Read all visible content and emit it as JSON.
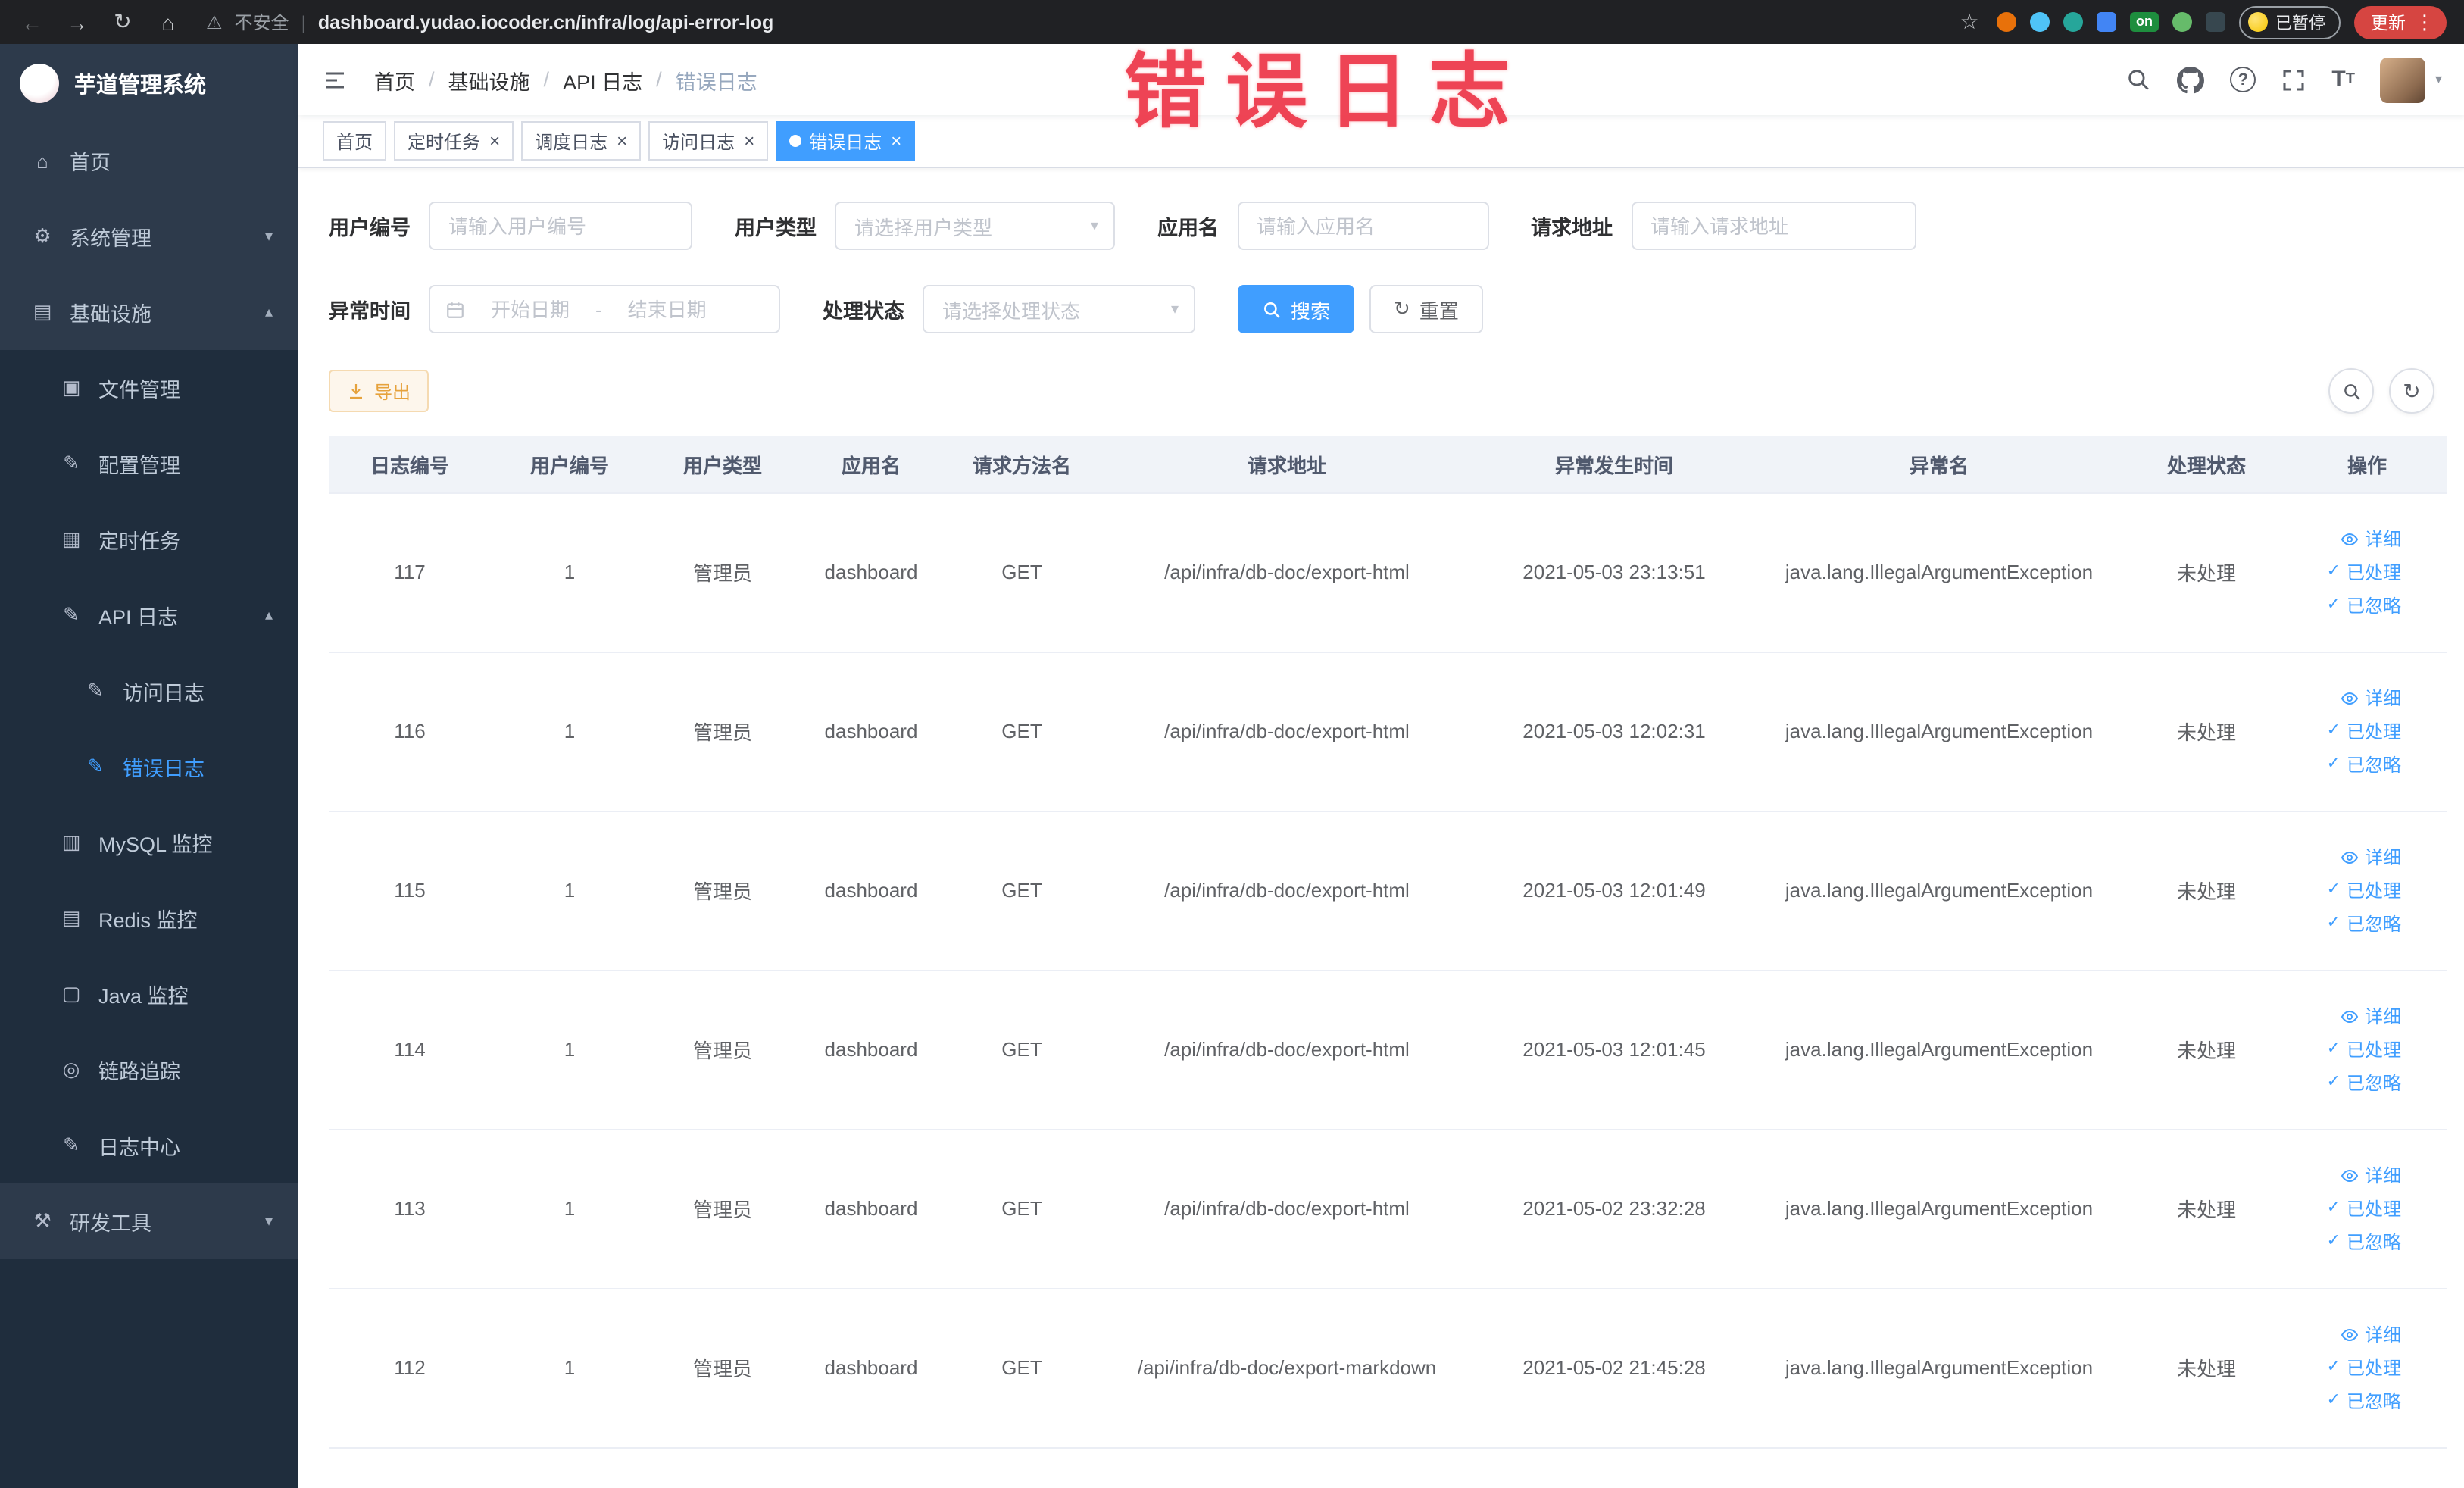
{
  "browser": {
    "security_label": "不安全",
    "url": "dashboard.yudao.iocoder.cn/infra/log/api-error-log",
    "extension_on_badge": "on",
    "paused_badge": "已暂停",
    "update_button": "更新"
  },
  "watermark_text": "错误日志",
  "sidebar": {
    "app_title": "芋道管理系统",
    "items": {
      "home": "首页",
      "system": "系统管理",
      "infra": "基础设施",
      "file": "文件管理",
      "config": "配置管理",
      "job": "定时任务",
      "api_log": "API 日志",
      "access_log": "访问日志",
      "error_log": "错误日志",
      "mysql": "MySQL 监控",
      "redis": "Redis 监控",
      "java": "Java 监控",
      "trace": "链路追踪",
      "log_center": "日志中心",
      "dev_tools": "研发工具"
    }
  },
  "navbar": {
    "breadcrumb": [
      "首页",
      "基础设施",
      "API 日志",
      "错误日志"
    ]
  },
  "tabs": [
    "首页",
    "定时任务",
    "调度日志",
    "访问日志",
    "错误日志"
  ],
  "filters": {
    "user_id_label": "用户编号",
    "user_id_placeholder": "请输入用户编号",
    "user_type_label": "用户类型",
    "user_type_placeholder": "请选择用户类型",
    "app_name_label": "应用名",
    "app_name_placeholder": "请输入应用名",
    "request_url_label": "请求地址",
    "request_url_placeholder": "请输入请求地址",
    "exception_time_label": "异常时间",
    "date_start_placeholder": "开始日期",
    "date_separator": "-",
    "date_end_placeholder": "结束日期",
    "process_status_label": "处理状态",
    "process_status_placeholder": "请选择处理状态",
    "search_button": "搜索",
    "reset_button": "重置"
  },
  "toolbar": {
    "export_button": "导出"
  },
  "table": {
    "columns": [
      "日志编号",
      "用户编号",
      "用户类型",
      "应用名",
      "请求方法名",
      "请求地址",
      "异常发生时间",
      "异常名",
      "处理状态",
      "操作"
    ],
    "actions": {
      "detail": "详细",
      "processed": "已处理",
      "ignored": "已忽略"
    },
    "rows": [
      {
        "id": "117",
        "user_id": "1",
        "user_type": "管理员",
        "app": "dashboard",
        "method": "GET",
        "url": "/api/infra/db-doc/export-html",
        "time": "2021-05-03 23:13:51",
        "exception": "java.lang.IllegalArgumentException",
        "status": "未处理"
      },
      {
        "id": "116",
        "user_id": "1",
        "user_type": "管理员",
        "app": "dashboard",
        "method": "GET",
        "url": "/api/infra/db-doc/export-html",
        "time": "2021-05-03 12:02:31",
        "exception": "java.lang.IllegalArgumentException",
        "status": "未处理"
      },
      {
        "id": "115",
        "user_id": "1",
        "user_type": "管理员",
        "app": "dashboard",
        "method": "GET",
        "url": "/api/infra/db-doc/export-html",
        "time": "2021-05-03 12:01:49",
        "exception": "java.lang.IllegalArgumentException",
        "status": "未处理"
      },
      {
        "id": "114",
        "user_id": "1",
        "user_type": "管理员",
        "app": "dashboard",
        "method": "GET",
        "url": "/api/infra/db-doc/export-html",
        "time": "2021-05-03 12:01:45",
        "exception": "java.lang.IllegalArgumentException",
        "status": "未处理"
      },
      {
        "id": "113",
        "user_id": "1",
        "user_type": "管理员",
        "app": "dashboard",
        "method": "GET",
        "url": "/api/infra/db-doc/export-html",
        "time": "2021-05-02 23:32:28",
        "exception": "java.lang.IllegalArgumentException",
        "status": "未处理"
      },
      {
        "id": "112",
        "user_id": "1",
        "user_type": "管理员",
        "app": "dashboard",
        "method": "GET",
        "url": "/api/infra/db-doc/export-markdown",
        "time": "2021-05-02 21:45:28",
        "exception": "java.lang.IllegalArgumentException",
        "status": "未处理"
      }
    ]
  }
}
